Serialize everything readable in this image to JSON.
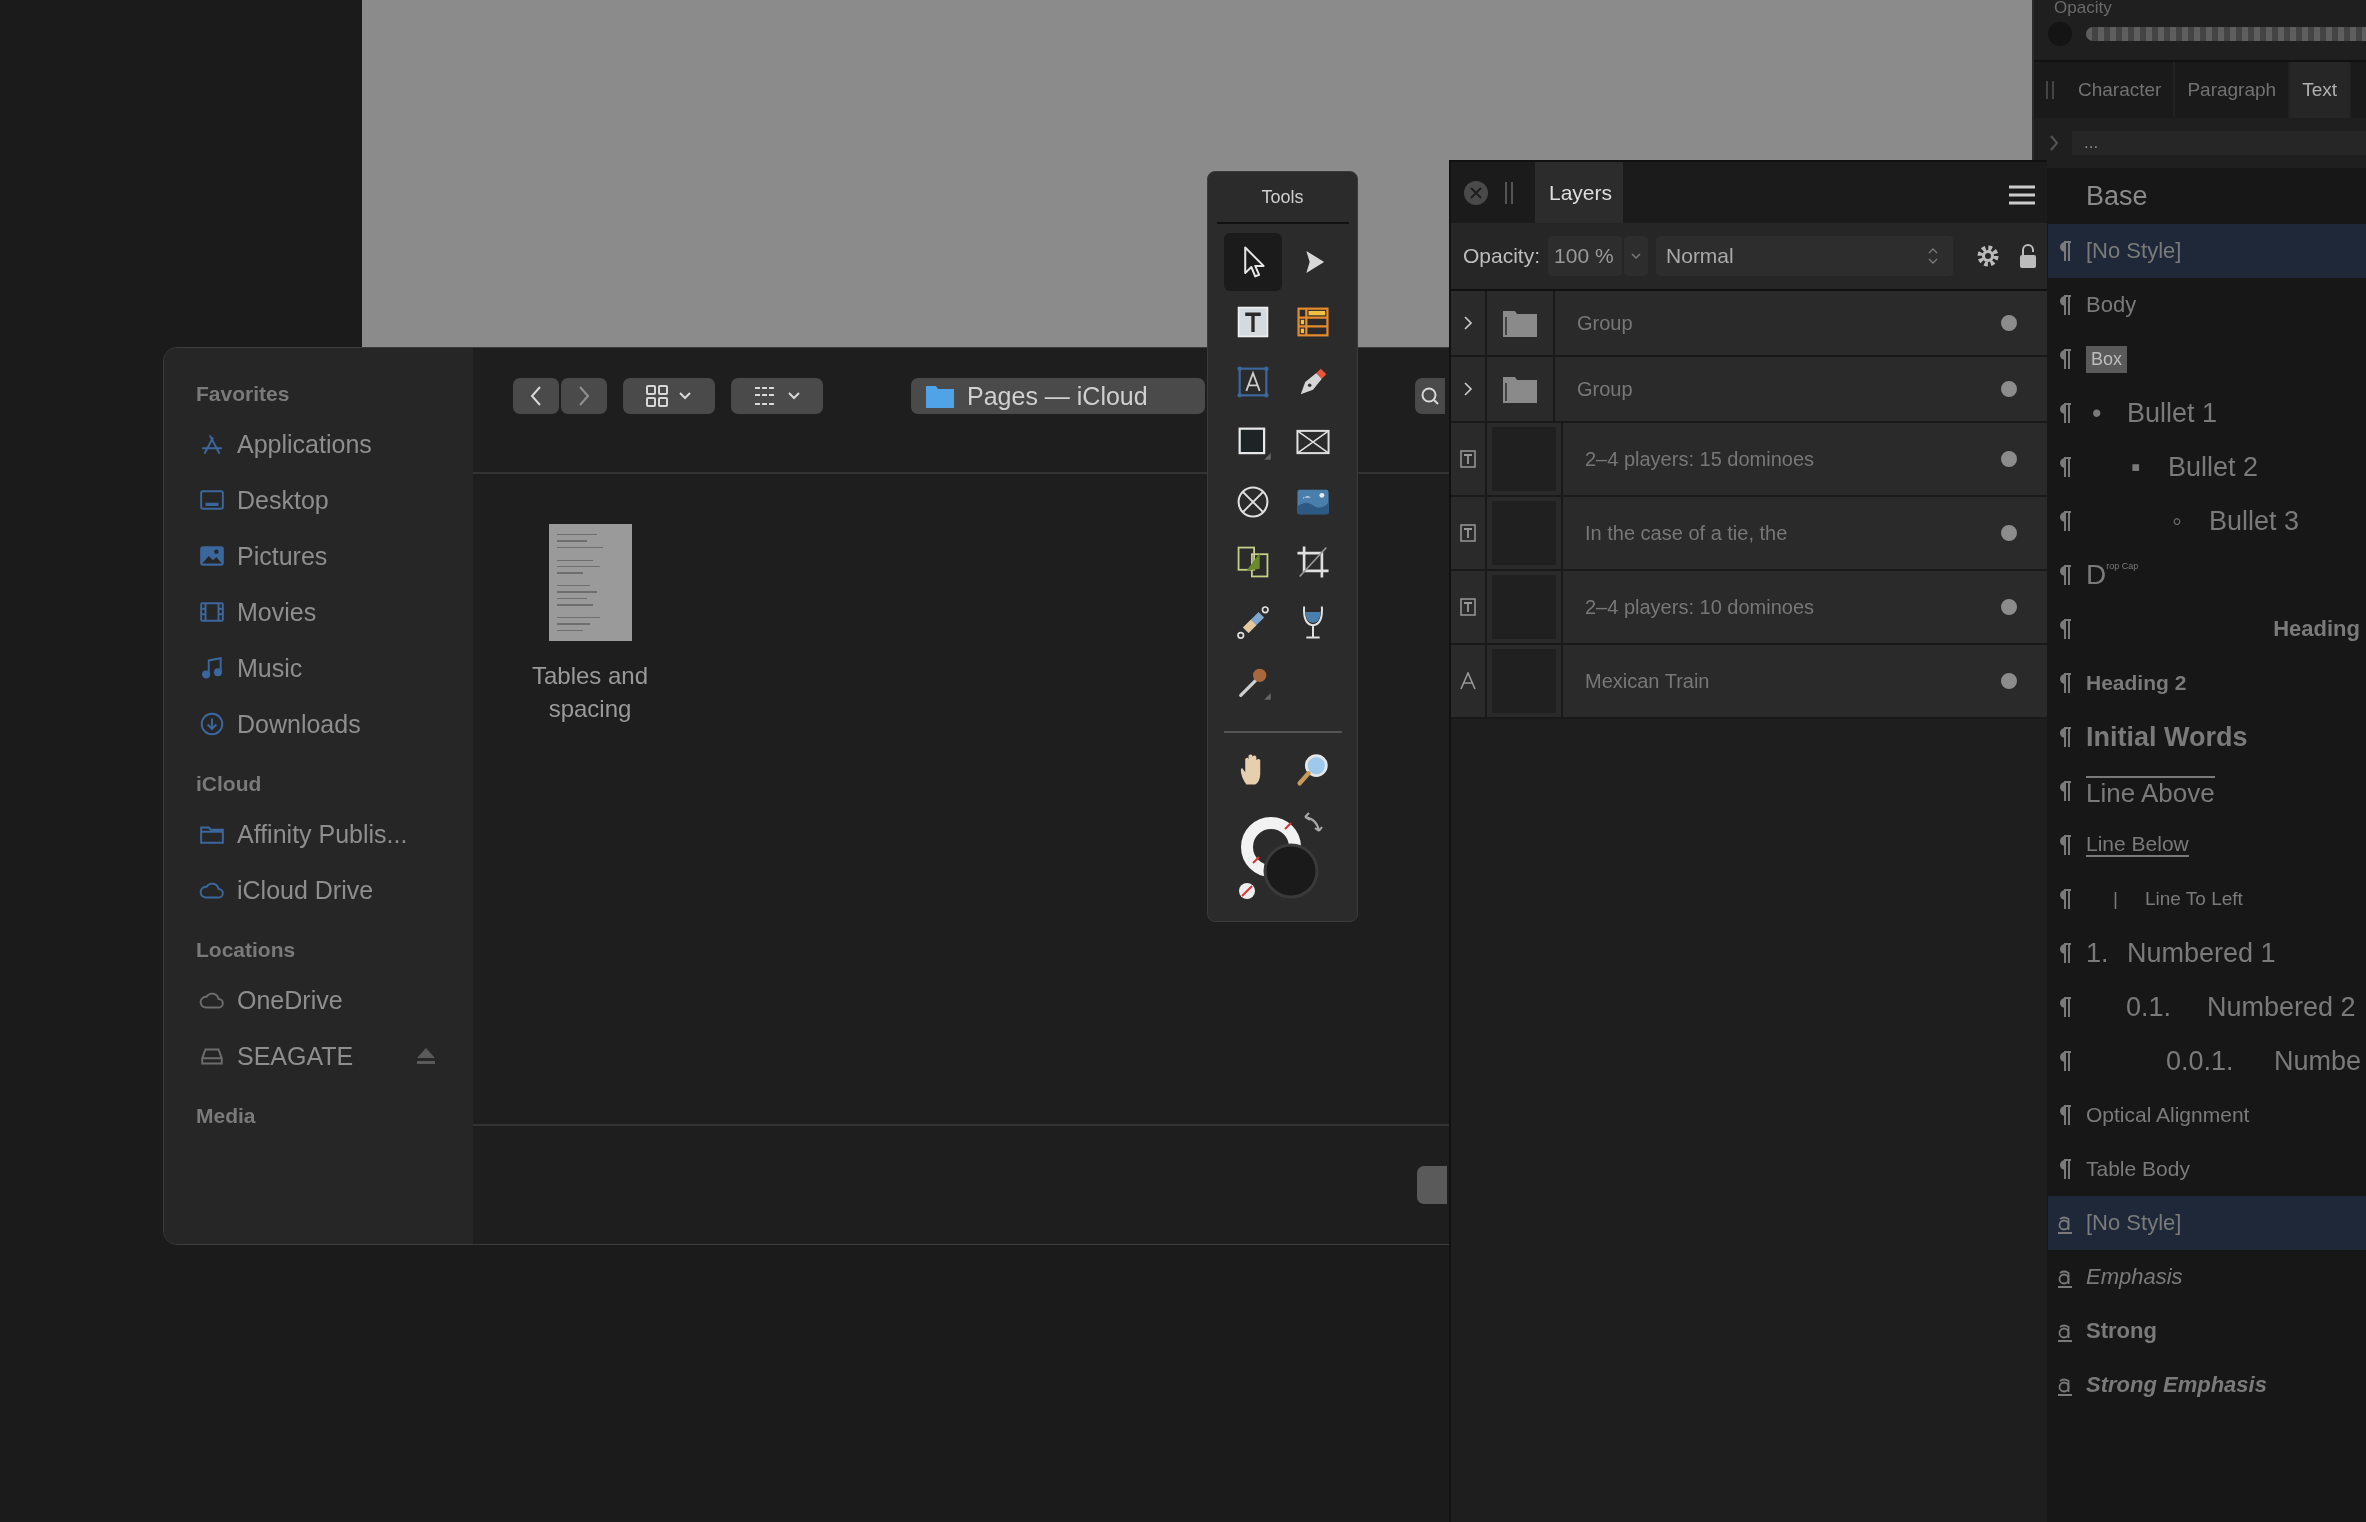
{
  "finder": {
    "sidebar": {
      "sections": [
        {
          "title": "Favorites",
          "items": [
            {
              "label": "Applications",
              "kind": "apps",
              "selected": false
            },
            {
              "label": "Desktop",
              "kind": "desktop",
              "selected": false
            },
            {
              "label": "Pictures",
              "kind": "pictures",
              "selected": false
            },
            {
              "label": "Movies",
              "kind": "movies",
              "selected": false
            },
            {
              "label": "Music",
              "kind": "music",
              "selected": false
            },
            {
              "label": "Downloads",
              "kind": "downloads",
              "selected": false
            }
          ]
        },
        {
          "title": "iCloud",
          "items": [
            {
              "label": "Affinity Publis...",
              "kind": "folder",
              "selected": false
            },
            {
              "label": "iCloud Drive",
              "kind": "cloud",
              "selected": false
            }
          ]
        },
        {
          "title": "Locations",
          "items": [
            {
              "label": "OneDrive",
              "kind": "cloud-grey",
              "selected": false
            },
            {
              "label": "SEAGATE",
              "kind": "disk",
              "selected": false,
              "ejectable": true
            }
          ]
        },
        {
          "title": "Media"
        }
      ]
    },
    "path": "Pages — iCloud",
    "files": [
      {
        "name": "Tables and spacing",
        "selected": false
      }
    ]
  },
  "tools": {
    "title": "Tools",
    "items": [
      {
        "kind": "pointer",
        "selected": true
      },
      {
        "kind": "node",
        "selected": false
      },
      {
        "kind": "textframe",
        "selected": false
      },
      {
        "kind": "table",
        "selected": false
      },
      {
        "kind": "artistic",
        "selected": false
      },
      {
        "kind": "pen",
        "selected": false
      },
      {
        "kind": "rect",
        "selected": false
      },
      {
        "kind": "frame",
        "selected": false
      },
      {
        "kind": "ellipseframe",
        "selected": false
      },
      {
        "kind": "image",
        "selected": false
      },
      {
        "kind": "link",
        "selected": false
      },
      {
        "kind": "crop",
        "selected": false
      },
      {
        "kind": "fill",
        "selected": false
      },
      {
        "kind": "glass",
        "selected": false
      },
      {
        "kind": "picker",
        "selected": false
      }
    ],
    "nav": [
      {
        "kind": "hand",
        "selected": false
      },
      {
        "kind": "zoom",
        "selected": false
      }
    ]
  },
  "layers": {
    "tab": "Layers",
    "opacity_label": "Opacity:",
    "opacity": "100 %",
    "blend": "Normal",
    "rows": [
      {
        "kind": "group",
        "name": "Group",
        "visible": true,
        "selected": false
      },
      {
        "kind": "group",
        "name": "Group",
        "visible": true,
        "selected": false
      },
      {
        "kind": "text",
        "name": "2–4 players: 15 dominoes",
        "visible": true,
        "selected": false
      },
      {
        "kind": "text",
        "name": "In the case of a tie, the",
        "visible": true,
        "selected": false
      },
      {
        "kind": "text",
        "name": "2–4 players: 10 dominoes",
        "visible": true,
        "selected": false
      },
      {
        "kind": "artistic",
        "name": "Mexican Train",
        "visible": true,
        "selected": false
      }
    ]
  },
  "styles": {
    "opacity_label": "Opacity",
    "tabs": [
      {
        "label": "Character",
        "selected": false
      },
      {
        "label": "Paragraph",
        "selected": false
      },
      {
        "label": "Text",
        "selected": true
      }
    ],
    "path": "...",
    "group": "Base",
    "paragraph_styles": [
      {
        "kind": "plain",
        "label": "[No Style]",
        "selected": true
      },
      {
        "kind": "plain",
        "label": "Body",
        "selected": false
      },
      {
        "kind": "box",
        "label": "Box",
        "selected": false
      },
      {
        "kind": "bullet1",
        "marker": "•",
        "label": "Bullet 1",
        "selected": false
      },
      {
        "kind": "bullet2",
        "marker": "▪",
        "label": "Bullet 2",
        "selected": false
      },
      {
        "kind": "bullet3",
        "marker": "◦",
        "label": "Bullet 3",
        "selected": false
      },
      {
        "kind": "dropcap",
        "label": "D$^{rop Cap}$",
        "selected": false
      },
      {
        "kind": "heading",
        "label": "Heading",
        "selected": false
      },
      {
        "kind": "heading2",
        "label": "Heading 2",
        "selected": false
      },
      {
        "kind": "initial",
        "label": "Initial Words",
        "selected": false
      },
      {
        "kind": "lineabove",
        "label": "Line Above",
        "selected": false
      },
      {
        "kind": "linebelow",
        "label": "Line Below",
        "selected": false
      },
      {
        "kind": "lineleft",
        "marker": "|",
        "label": "Line To Left",
        "selected": false
      },
      {
        "kind": "num1",
        "marker": "1.",
        "label": "Numbered 1",
        "selected": false
      },
      {
        "kind": "num2",
        "marker": "0.1.",
        "label": "Numbered 2",
        "selected": false
      },
      {
        "kind": "num3",
        "marker": "0.0.1.",
        "label": "Numbe",
        "selected": false
      },
      {
        "kind": "small",
        "label": "Optical Alignment",
        "selected": false
      },
      {
        "kind": "small",
        "label": "Table Body",
        "selected": false
      }
    ],
    "character_styles": [
      {
        "kind": "plain",
        "label": "[No Style]",
        "selected": true
      },
      {
        "kind": "italic",
        "label": "Emphasis",
        "selected": false
      },
      {
        "kind": "bold",
        "label": "Strong",
        "selected": false
      },
      {
        "kind": "bolditalic",
        "label": "Strong Emphasis",
        "selected": false
      }
    ]
  }
}
